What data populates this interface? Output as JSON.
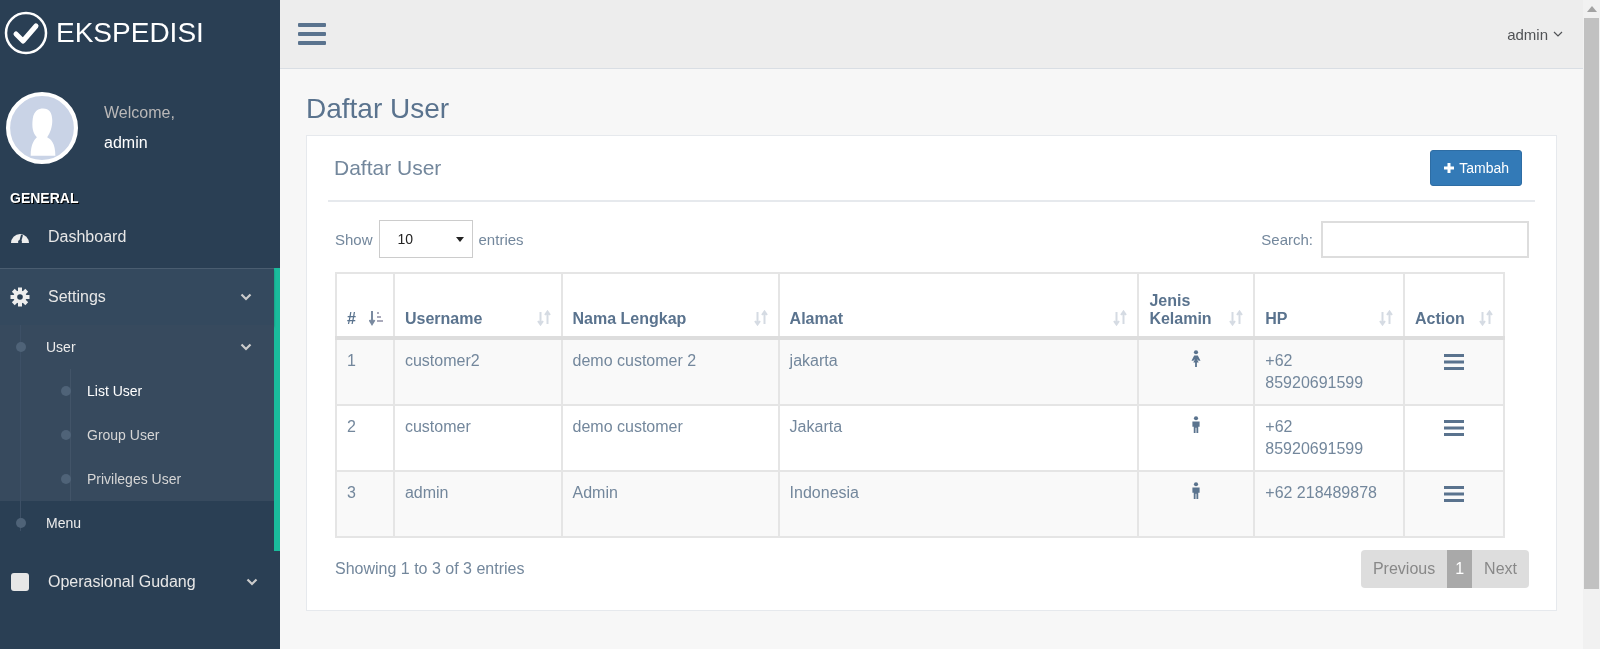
{
  "brand": {
    "title": "EKSPEDISI"
  },
  "profile": {
    "welcome": "Welcome,",
    "name": "admin"
  },
  "sidebar": {
    "section": "GENERAL",
    "items": [
      {
        "label": "Dashboard"
      },
      {
        "label": "Settings",
        "expanded": true,
        "children": [
          {
            "label": "User",
            "expanded": true,
            "children": [
              {
                "label": "List User",
                "selected": true
              },
              {
                "label": "Group User",
                "selected": false
              },
              {
                "label": "Privileges User",
                "selected": false
              }
            ]
          },
          {
            "label": "Menu"
          }
        ]
      },
      {
        "label": "Operasional Gudang",
        "expanded": false
      }
    ]
  },
  "topbar": {
    "user": "admin"
  },
  "page": {
    "title": "Daftar User"
  },
  "panel": {
    "title": "Daftar User",
    "add_button": "Tambah"
  },
  "table_controls": {
    "show": "Show",
    "page_size": "10",
    "entries": "entries",
    "search_label": "Search:"
  },
  "table": {
    "columns": [
      {
        "label": "#",
        "sorted": true
      },
      {
        "label": "Username",
        "sorted": false
      },
      {
        "label": "Nama Lengkap",
        "sorted": false
      },
      {
        "label": "Alamat",
        "sorted": false
      },
      {
        "label": "Jenis Kelamin",
        "sorted": false
      },
      {
        "label": "HP",
        "sorted": false
      },
      {
        "label": "Action",
        "sorted": false
      }
    ],
    "rows": [
      {
        "no": "1",
        "username": "customer2",
        "name": "demo customer 2",
        "address": "jakarta",
        "kind": "female",
        "phone": "+62 85920691599"
      },
      {
        "no": "2",
        "username": "customer",
        "name": "demo customer",
        "address": "Jakarta",
        "kind": "male",
        "phone": "+62 85920691599"
      },
      {
        "no": "3",
        "username": "admin",
        "name": "Admin",
        "address": "Indonesia",
        "kind": "male",
        "phone": "+62 218489878"
      }
    ]
  },
  "footer": {
    "info": "Showing 1 to 3 of 3 entries",
    "previous": "Previous",
    "page": "1",
    "next": "Next"
  }
}
